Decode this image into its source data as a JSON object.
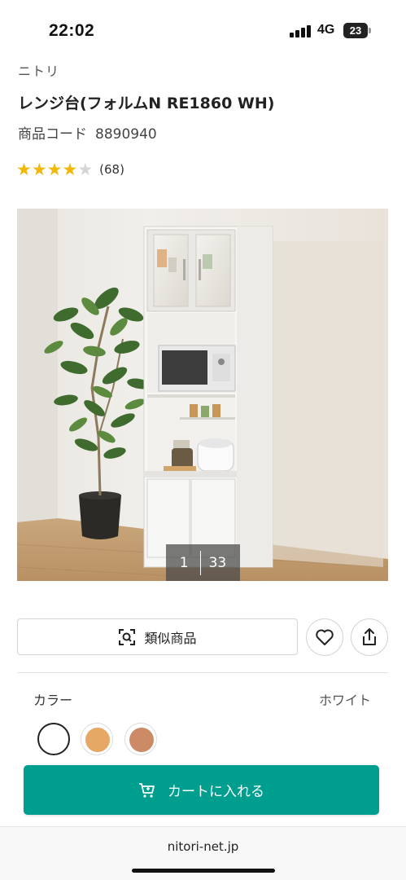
{
  "status_bar": {
    "time": "22:02",
    "network": "4G",
    "battery": "23"
  },
  "product": {
    "brand": "ニトリ",
    "title": "レンジ台(フォルムN RE1860 WH)",
    "code_label": "商品コード",
    "code_value": "8890940",
    "rating": {
      "stars_filled": 4,
      "stars_total": 5,
      "review_count": "(68)"
    }
  },
  "gallery": {
    "current": "1",
    "total": "33"
  },
  "actions": {
    "similar_label": "類似商品",
    "favorite_icon": "heart-icon",
    "share_icon": "share-icon"
  },
  "color": {
    "label": "カラー",
    "selected_name": "ホワイト",
    "swatches": [
      {
        "color": "#ffffff",
        "selected": true
      },
      {
        "color": "#e6a865",
        "selected": false
      },
      {
        "color": "#cc8a67",
        "selected": false
      }
    ]
  },
  "cart": {
    "label": "カートに入れる",
    "color": "#009e8e"
  },
  "browser": {
    "url": "nitori-net.jp"
  }
}
